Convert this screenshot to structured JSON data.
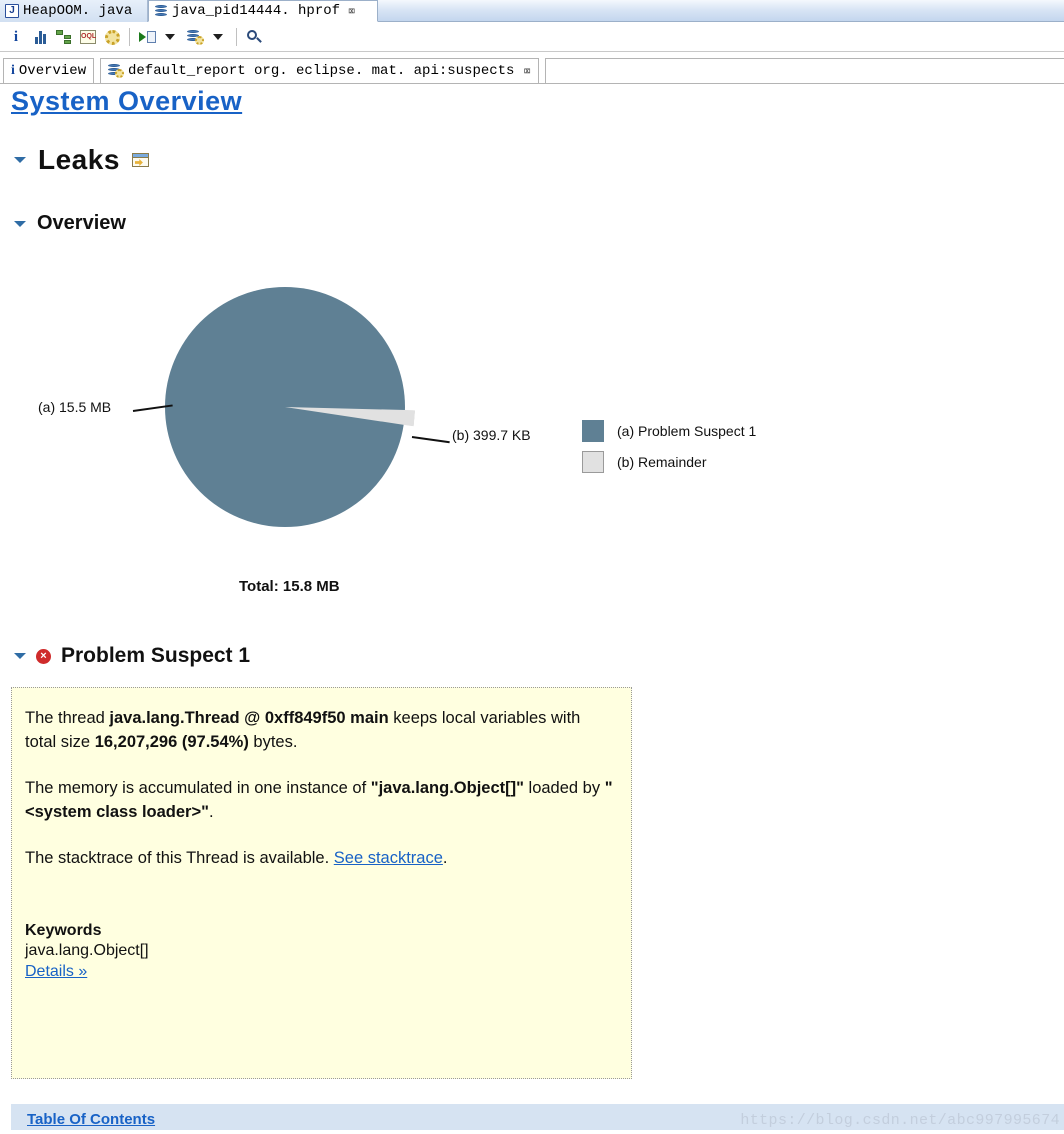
{
  "window": {
    "editor_tabs": [
      {
        "label": "HeapOOM. java",
        "icon": "java-file-icon",
        "active": false,
        "closable": false,
        "letter": "J"
      },
      {
        "label": "java_pid14444. hprof",
        "icon": "heap-dump-icon",
        "active": true,
        "closable": true,
        "close_glyph": "⌧"
      }
    ]
  },
  "toolbar": {
    "items": [
      {
        "name": "overview-info-icon",
        "glyph": "i"
      },
      {
        "name": "histogram-icon"
      },
      {
        "name": "dominator-tree-icon"
      },
      {
        "name": "oql-icon",
        "glyph": "OQL"
      },
      {
        "name": "inspector-gear-icon"
      },
      {
        "name": "run-expert-system-test-icon"
      },
      {
        "name": "run-expert-system-dropdown"
      },
      {
        "name": "heap-dump-queries-icon"
      },
      {
        "name": "heap-dump-queries-dropdown"
      },
      {
        "name": "search-icon"
      }
    ]
  },
  "report_tabs": [
    {
      "label": "Overview",
      "icon": "info-icon",
      "glyph": "i",
      "closable": false
    },
    {
      "label": "default_report  org. eclipse. mat. api:suspects",
      "icon": "report-icon",
      "closable": true,
      "close_glyph": "⌧"
    }
  ],
  "report": {
    "title": "System Overview",
    "sections": {
      "leaks": {
        "label": "Leaks",
        "icon": "open-in-window-icon"
      },
      "overview": {
        "label": "Overview"
      },
      "problem_suspect": {
        "label": "Problem Suspect 1",
        "icon": "error-icon",
        "glyph": "×"
      }
    },
    "suspect": {
      "p1_pre": "The thread ",
      "p1_b1": "java.lang.Thread @ 0xff849f50 main",
      "p1_mid": " keeps local variables with total size ",
      "p1_b2": "16,207,296 (97.54%)",
      "p1_post": " bytes.",
      "p2_pre": "The memory is accumulated in one instance of ",
      "p2_b1": "\"java.lang.Object[]\"",
      "p2_mid": " loaded by ",
      "p2_b2": "\"<system class loader>\"",
      "p2_post": ".",
      "p3_pre": "The stacktrace of this Thread is available. ",
      "p3_link": "See stacktrace",
      "p3_post": ".",
      "keywords_label": "Keywords",
      "keywords_value": "java.lang.Object[]",
      "details_link": "Details »"
    }
  },
  "footer": {
    "toc_link": "Table Of Contents",
    "watermark": "https://blog.csdn.net/abc997995674"
  },
  "colors": {
    "suspect_slice": "#5f8094",
    "remainder_slice": "#e1e1e1",
    "link": "#1862c6",
    "note_background": "#ffffe0",
    "footer_background": "#d6e3f2"
  },
  "chart_data": {
    "type": "pie",
    "title": "",
    "total_label": "Total: 15.8 MB",
    "categories": [
      "(a)  Problem Suspect 1",
      "(b)  Remainder"
    ],
    "slices": [
      {
        "key": "(a)",
        "legend": "(a)  Problem Suspect 1",
        "label": "(a)  15.5 MB",
        "value": 15.5,
        "unit": "MB",
        "bytes": 16207296,
        "percent": 97.54,
        "color": "#5f8094"
      },
      {
        "key": "(b)",
        "legend": "(b)  Remainder",
        "label": "(b)  399.7 KB",
        "value": 399.7,
        "unit": "KB",
        "bytes": 409293,
        "percent": 2.46,
        "color": "#e1e1e1"
      }
    ],
    "total_value": 15.8,
    "total_unit": "MB",
    "legend_position": "right",
    "grid": false,
    "xlabel": "",
    "ylabel": ""
  }
}
